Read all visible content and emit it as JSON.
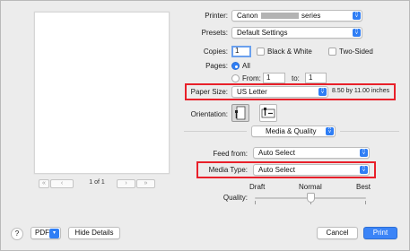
{
  "preview": {
    "first_icon": "«",
    "prev_icon": "‹",
    "next_icon": "›",
    "last_icon": "»",
    "page_info": "1 of 1"
  },
  "printer": {
    "label": "Printer:",
    "value_prefix": "Canon",
    "value_suffix": "series"
  },
  "presets": {
    "label": "Presets:",
    "value": "Default Settings"
  },
  "copies": {
    "label": "Copies:",
    "value": "1",
    "bw_label": "Black & White",
    "two_sided_label": "Two-Sided"
  },
  "pages": {
    "label": "Pages:",
    "all_label": "All",
    "from_label": "From:",
    "from_value": "1",
    "to_label": "to:",
    "to_value": "1"
  },
  "paper_size": {
    "label": "Paper Size:",
    "value": "US Letter",
    "dimensions": "8.50 by 11.00 inches"
  },
  "orientation": {
    "label": "Orientation:"
  },
  "section_menu": {
    "value": "Media & Quality"
  },
  "feed_from": {
    "label": "Feed from:",
    "value": "Auto Select"
  },
  "media_type": {
    "label": "Media Type:",
    "value": "Auto Select"
  },
  "quality": {
    "label": "Quality:",
    "draft": "Draft",
    "normal": "Normal",
    "best": "Best",
    "level": 0.5
  },
  "footer": {
    "help": "?",
    "pdf": "PDF",
    "hide_details": "Hide Details",
    "cancel": "Cancel",
    "print": "Print"
  },
  "colors": {
    "accent": "#2f7ef5",
    "highlight_box": "#e8202a"
  }
}
